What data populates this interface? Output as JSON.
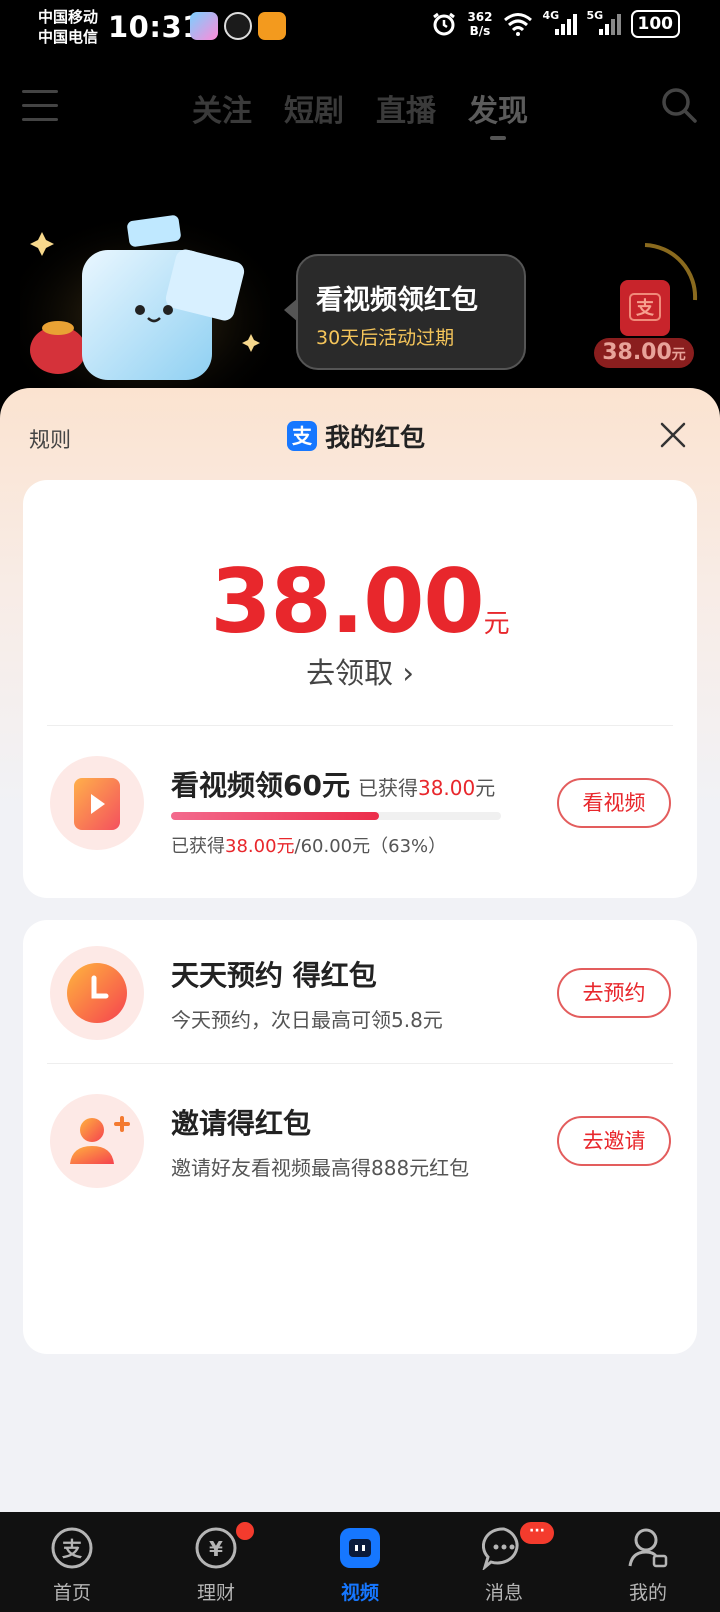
{
  "status_bar": {
    "carrier_1": "中国移动",
    "carrier_2": "中国电信",
    "time": "10:31",
    "net_speed_value": "362",
    "net_speed_unit": "B/s",
    "signal_1": "4G",
    "signal_2": "5G",
    "battery": "100"
  },
  "top_nav": {
    "tabs": [
      {
        "label": "关注"
      },
      {
        "label": "短剧"
      },
      {
        "label": "直播"
      },
      {
        "label": "发现"
      }
    ],
    "active_tab": "发现"
  },
  "banner": {
    "bubble_title": "看视频领红包",
    "bubble_subtitle": "30天后活动过期",
    "side_amount": "38.00",
    "side_unit": "元"
  },
  "sheet": {
    "rules_label": "规则",
    "title": "我的红包",
    "logo_char": "支",
    "amount": "38.00",
    "amount_unit": "元",
    "claim_label": "去领取",
    "claim_chevron": "›",
    "tasks": [
      {
        "title": "看视频领60元",
        "earned_prefix": "已获得",
        "earned_value": "38.00",
        "earned_unit": "元",
        "progress": 0.63,
        "progress_prefix": "已获得",
        "progress_value": "38.00元",
        "progress_suffix": "/60.00元（63%）",
        "button": "看视频"
      },
      {
        "title": "天天预约 得红包",
        "desc": "今天预约，次日最高可领5.8元",
        "button": "去预约"
      },
      {
        "title": "邀请得红包",
        "desc": "邀请好友看视频最高得888元红包",
        "button": "去邀请"
      }
    ]
  },
  "tab_bar": {
    "items": [
      {
        "label": "首页",
        "icon": "alipay-home-icon"
      },
      {
        "label": "理财",
        "icon": "wealth-icon"
      },
      {
        "label": "视频",
        "icon": "video-icon"
      },
      {
        "label": "消息",
        "icon": "message-icon"
      },
      {
        "label": "我的",
        "icon": "profile-icon"
      }
    ],
    "active": "视频",
    "message_badge": "···"
  },
  "colors": {
    "accent_red": "#e8272c",
    "alipay_blue": "#1677ff",
    "gold": "#f5c55a"
  }
}
